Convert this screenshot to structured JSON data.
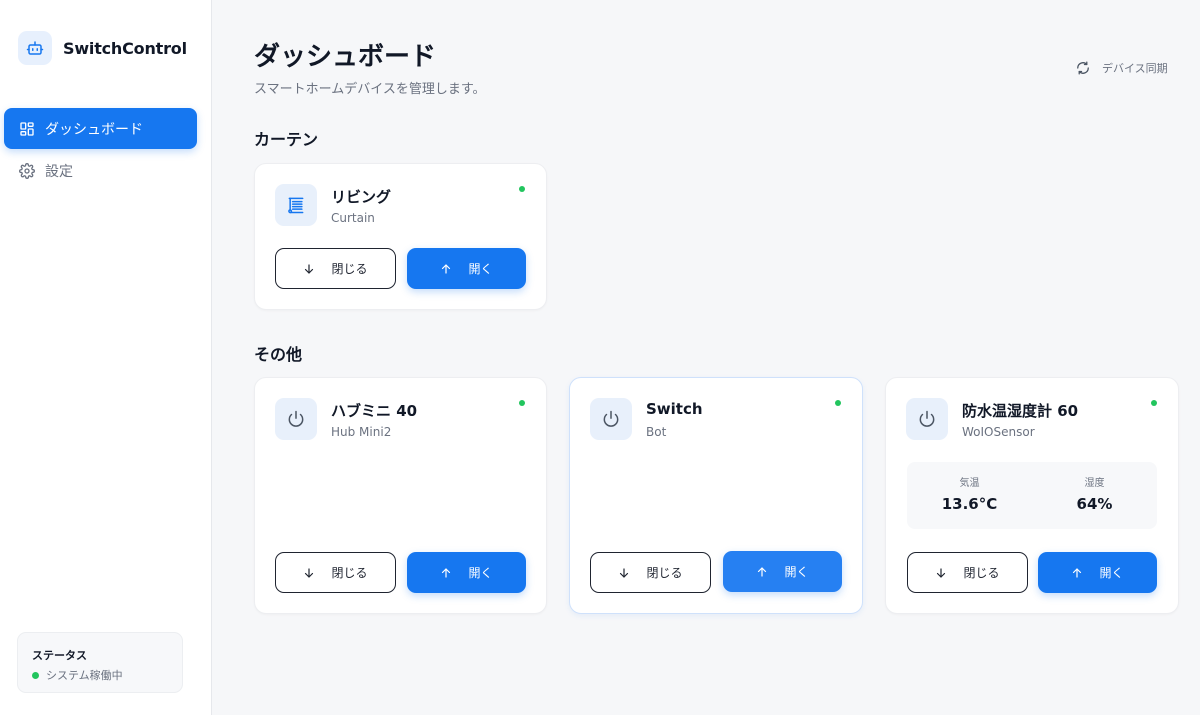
{
  "app": {
    "name": "SwitchControl"
  },
  "sidebar": {
    "items": [
      {
        "label": "ダッシュボード",
        "icon": "grid-icon",
        "active": true
      },
      {
        "label": "設定",
        "icon": "gear-icon",
        "active": false
      }
    ],
    "status": {
      "title": "ステータス",
      "text": "システム稼働中",
      "color": "#22c55e"
    }
  },
  "header": {
    "title": "ダッシュボード",
    "subtitle": "スマートホームデバイスを管理します。",
    "sync_label": "デバイス同期"
  },
  "sections": [
    {
      "title": "カーテン",
      "devices": [
        {
          "name": "リビング",
          "type": "Curtain",
          "icon": "curtain-icon",
          "online": true,
          "close_label": "閉じる",
          "open_label": "開く"
        }
      ]
    },
    {
      "title": "その他",
      "devices": [
        {
          "name": "ハブミニ 40",
          "type": "Hub Mini2",
          "icon": "power-icon",
          "online": true,
          "close_label": "閉じる",
          "open_label": "開く"
        },
        {
          "name": "Switch",
          "type": "Bot",
          "icon": "power-icon",
          "online": true,
          "close_label": "閉じる",
          "open_label": "開く"
        },
        {
          "name": "防水温湿度計 60",
          "type": "WoIOSensor",
          "icon": "power-icon",
          "online": true,
          "close_label": "閉じる",
          "open_label": "開く",
          "sensor": {
            "temp_label": "気温",
            "temp_value": "13.6°C",
            "humidity_label": "湿度",
            "humidity_value": "64%"
          }
        }
      ]
    }
  ],
  "colors": {
    "accent": "#1677f0",
    "online": "#22c55e",
    "icon_bg": "#e8f0fb"
  }
}
